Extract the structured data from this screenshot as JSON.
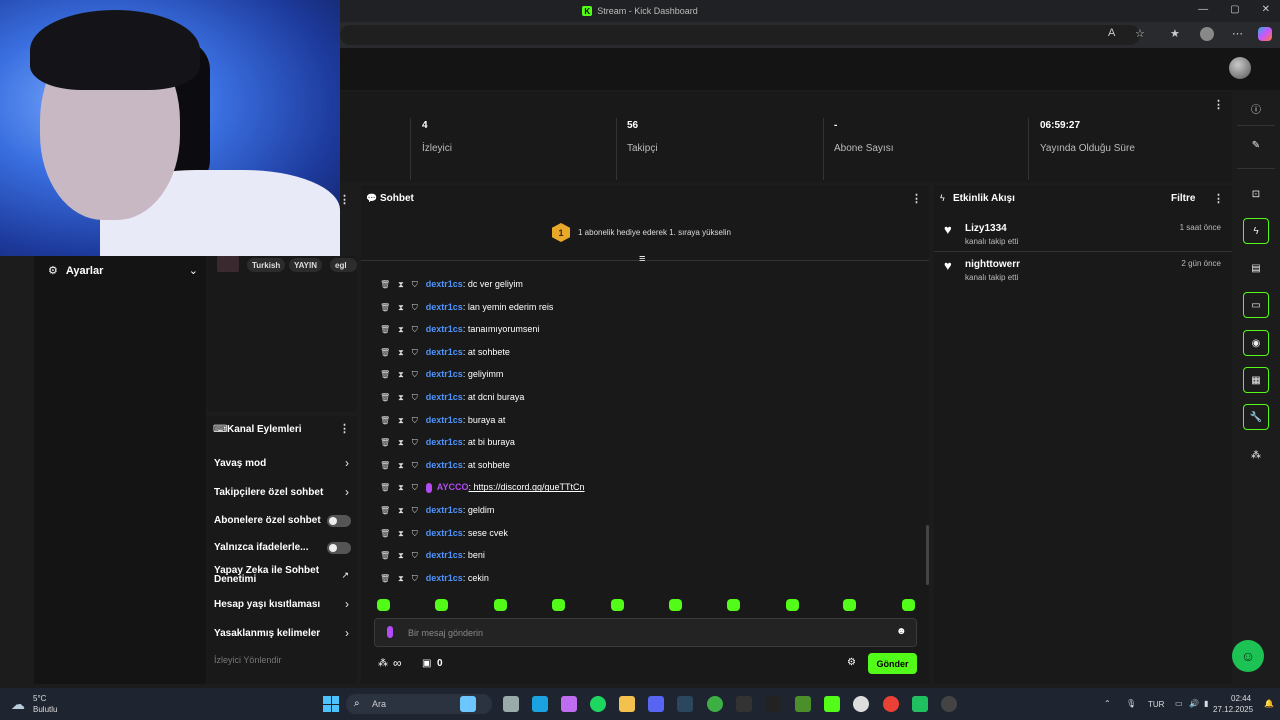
{
  "window": {
    "title": "Stream - Kick Dashboard",
    "minimize": "—",
    "maximize": "▢",
    "close": "✕"
  },
  "stats": [
    {
      "value": "4",
      "label": "İzleyici"
    },
    {
      "value": "56",
      "label": "Takipçi"
    },
    {
      "value": "-",
      "label": "Abone Sayısı"
    },
    {
      "value": "06:59:27",
      "label": "Yayında Olduğu Süre"
    }
  ],
  "left": {
    "settings_label": "Ayarlar"
  },
  "tags": [
    "Turkish",
    "YAYIN",
    "egl"
  ],
  "channel_actions": {
    "title": "Kanal Eylemleri",
    "items": [
      {
        "label": "Yavaş mod",
        "control": "chevron"
      },
      {
        "label": "Takipçilere özel sohbet",
        "control": "chevron"
      },
      {
        "label": "Abonelere özel sohbet",
        "control": "toggle"
      },
      {
        "label": "Yalnızca ifadelerle...",
        "control": "toggle"
      },
      {
        "label": "Yapay Zeka ile Sohbet Denetimi",
        "control": "external"
      },
      {
        "label": "Hesap yaşı kısıtlaması",
        "control": "chevron"
      },
      {
        "label": "Yasaklanmış kelimeler",
        "control": "chevron"
      },
      {
        "label": "İzleyici Yönlendir",
        "control": "none"
      }
    ]
  },
  "chat": {
    "title": "Sohbet",
    "banner_rank": "1",
    "banner_text": "1 abonelik hediye ederek 1. sıraya yükselin",
    "messages": [
      {
        "user": "dextr1cs",
        "text": ": dc ver geliyim"
      },
      {
        "user": "dextr1cs",
        "text": ": lan yemin ederim reis"
      },
      {
        "user": "dextr1cs",
        "text": ": tanaımıyorumseni"
      },
      {
        "user": "dextr1cs",
        "text": ": at sohbete"
      },
      {
        "user": "dextr1cs",
        "text": ": geliyimm"
      },
      {
        "user": "dextr1cs",
        "text": ": at dcni buraya"
      },
      {
        "user": "dextr1cs",
        "text": ": buraya at"
      },
      {
        "user": "dextr1cs",
        "text": ": at bi buraya"
      },
      {
        "user": "dextr1cs",
        "text": ": at sohbete"
      },
      {
        "user": "AYCCO",
        "text": ": https://discord.gg/gueTTtCn",
        "special": true
      },
      {
        "user": "dextr1cs",
        "text": ": geldim"
      },
      {
        "user": "dextr1cs",
        "text": ": sese cvek"
      },
      {
        "user": "dextr1cs",
        "text": ": beni"
      },
      {
        "user": "dextr1cs",
        "text": ": cekin"
      }
    ],
    "input_placeholder": "Bir mesaj gönderin",
    "points_value": "0",
    "send_label": "Gönder",
    "infinity": "∞"
  },
  "activity": {
    "title": "Etkinlik Akışı",
    "filter_label": "Filtre",
    "events": [
      {
        "user": "Lizy1334",
        "action": "kanalı takip etti",
        "time": "1 saat önce"
      },
      {
        "user": "nighttowerr",
        "action": "kanalı takip etti",
        "time": "2 gün önce"
      }
    ]
  },
  "taskbar": {
    "weather_temp": "5°C",
    "weather_desc": "Bulutlu",
    "search_label": "Ara",
    "lang": "TUR",
    "time": "02:44",
    "date": "27.12.2025"
  },
  "colors": {
    "kick_green": "#53fc18",
    "username_blue": "#4f95ff",
    "special_purple": "#b44cf5"
  }
}
